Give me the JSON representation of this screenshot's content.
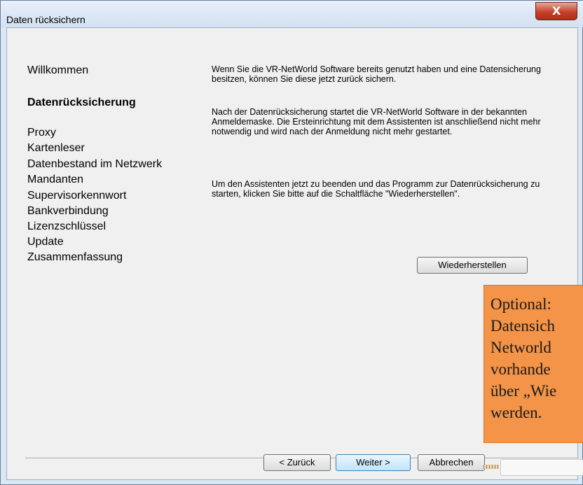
{
  "window": {
    "title": "Daten rücksichern",
    "close_glyph": "X"
  },
  "steps": [
    {
      "label": "Willkommen",
      "active": false
    },
    {
      "label": "Datenrücksicherung",
      "active": true
    },
    {
      "label": "Proxy",
      "active": false
    },
    {
      "label": "Kartenleser",
      "active": false
    },
    {
      "label": "Datenbestand im Netzwerk",
      "active": false
    },
    {
      "label": "Mandanten",
      "active": false
    },
    {
      "label": "Supervisorkennwort",
      "active": false
    },
    {
      "label": "Bankverbindung",
      "active": false
    },
    {
      "label": "Lizenzschlüssel",
      "active": false
    },
    {
      "label": "Update",
      "active": false
    },
    {
      "label": "Zusammenfassung",
      "active": false
    }
  ],
  "content": {
    "paragraph_1": "Wenn Sie die VR-NetWorld Software bereits genutzt haben und eine Datensicherung besitzen, können Sie diese jetzt zurück sichern.",
    "paragraph_2": "Nach der Datenrücksicherung startet die VR-NetWorld Software in der bekannten Anmeldemaske. Die Ersteinrichtung mit dem Assistenten ist anschließend nicht mehr notwendig und wird nach der Anmeldung nicht mehr gestartet.",
    "paragraph_3": "Um den Assistenten jetzt zu beenden und das Programm zur Datenrücksicherung zu starten, klicken Sie bitte auf die Schaltfläche \"Wiederherstellen\".",
    "restore_button": "Wiederherstellen"
  },
  "footer": {
    "back": "< Zurück",
    "next": "Weiter >",
    "cancel": "Abbrechen"
  },
  "callout": {
    "lines": [
      "Optional:",
      "Datensich",
      "Networld",
      "vorhande",
      "über „Wie",
      "werden."
    ],
    "color": "#f39448"
  }
}
